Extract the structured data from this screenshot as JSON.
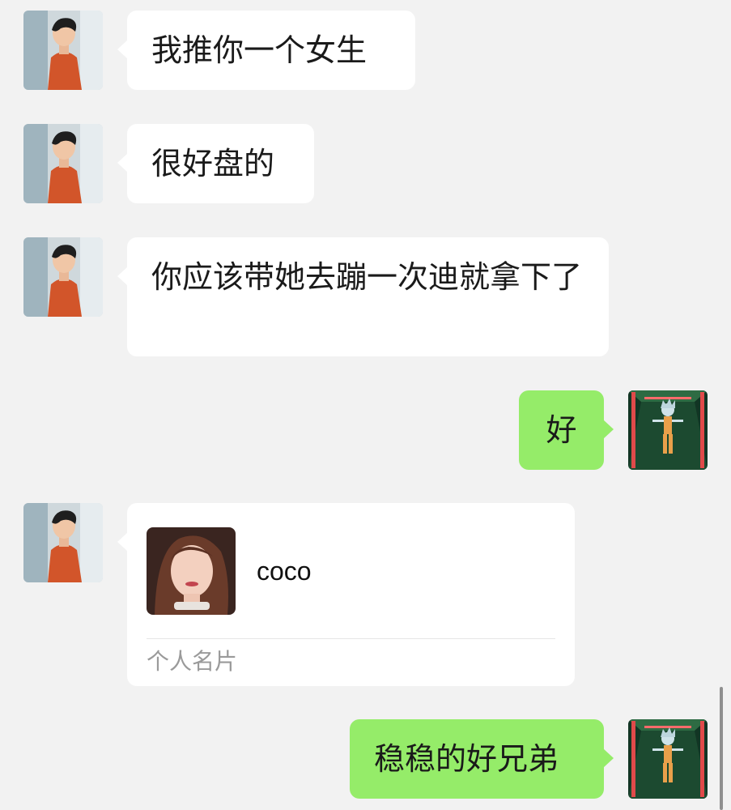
{
  "messages": [
    {
      "side": "received",
      "text": "我推你一个女生"
    },
    {
      "side": "received",
      "text": "很好盘的"
    },
    {
      "side": "received",
      "text": "你应该带她去蹦一次迪就拿下了"
    },
    {
      "side": "sent",
      "text": "好"
    },
    {
      "side": "received",
      "type": "contact_card",
      "card": {
        "name": "coco",
        "label": "个人名片"
      }
    },
    {
      "side": "sent",
      "text": "稳稳的好兄弟"
    }
  ],
  "colors": {
    "background": "#f2f2f2",
    "received_bubble": "#ffffff",
    "sent_bubble": "#95ec69"
  },
  "icons": {
    "friend_avatar": "friend-avatar-photo",
    "my_avatar": "cartoon-character-avatar",
    "card_photo": "contact-profile-photo"
  }
}
